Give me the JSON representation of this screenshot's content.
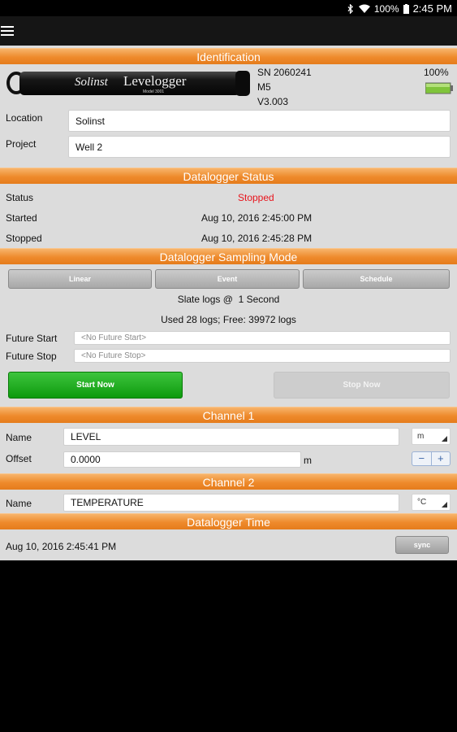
{
  "status_bar": {
    "battery": "100%",
    "time": "2:45 PM"
  },
  "identification": {
    "header": "Identification",
    "logo_brand": "Solinst",
    "logo_product": "Levelogger",
    "logo_model": "Model 3001",
    "serial": "SN 2060241",
    "model": "M5",
    "version": "V3.003",
    "battery_percent": "100%",
    "location_label": "Location",
    "location_value": "Solinst",
    "project_label": "Project",
    "project_value": "Well 2"
  },
  "datalogger_status": {
    "header": "Datalogger Status",
    "status_label": "Status",
    "status_value": "Stopped",
    "started_label": "Started",
    "started_value": "Aug 10, 2016 2:45:00 PM",
    "stopped_label": "Stopped",
    "stopped_value": "Aug 10, 2016 2:45:28 PM"
  },
  "sampling_mode": {
    "header": "Datalogger Sampling Mode",
    "tabs": [
      "Linear",
      "Event",
      "Schedule"
    ],
    "slate_logs": "Slate logs @  1 Second",
    "usage": "Used 28 logs; Free: 39972 logs",
    "future_start_label": "Future Start",
    "future_start_placeholder": "<No Future Start>",
    "future_stop_label": "Future Stop",
    "future_stop_placeholder": "<No Future Stop>",
    "start_button": "Start Now",
    "stop_button": "Stop Now"
  },
  "channel1": {
    "header": "Channel 1",
    "name_label": "Name",
    "name_value": "LEVEL",
    "unit": "m",
    "offset_label": "Offset",
    "offset_value": "0.0000",
    "offset_unit": "m",
    "minus": "−",
    "plus": "+"
  },
  "channel2": {
    "header": "Channel 2",
    "name_label": "Name",
    "name_value": "TEMPERATURE",
    "unit": "°C"
  },
  "datalogger_time": {
    "header": "Datalogger Time",
    "value": "Aug 10, 2016 2:45:41 PM",
    "sync_button": "sync"
  },
  "colors": {
    "accent_orange": "#ee8a2b",
    "status_stopped": "#e8141c",
    "start_green": "#1aa61a"
  }
}
